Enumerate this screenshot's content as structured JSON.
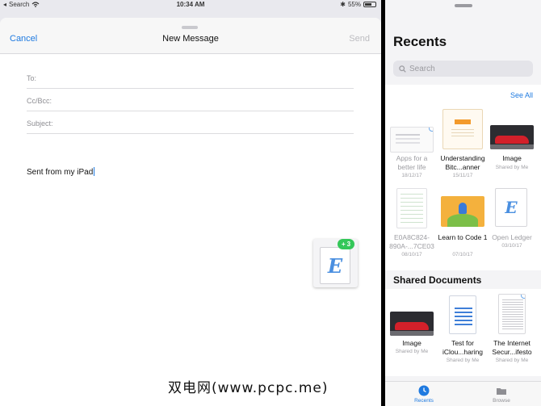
{
  "status_bar": {
    "back_app": "Search",
    "time": "10:34 AM",
    "battery": "55%"
  },
  "mail": {
    "cancel_label": "Cancel",
    "title": "New Message",
    "send_label": "Send",
    "to_label": "To:",
    "cc_label": "Cc/Bcc:",
    "subject_label": "Subject:",
    "body": "Sent from my iPad"
  },
  "drag": {
    "badge_count": "3",
    "glyph": "E"
  },
  "files": {
    "title": "Recents",
    "search_placeholder": "Search",
    "see_all_label": "See All",
    "recents": [
      {
        "name": "Apps for a better life",
        "date": "18/12/17"
      },
      {
        "name": "Understanding Bitc...anner",
        "date": "15/11/17"
      },
      {
        "name": "Image",
        "date": "Shared by Me"
      },
      {
        "name": "E0A8C824-890A-...7CE03",
        "date": "08/10/17"
      },
      {
        "name": "Learn to Code 1",
        "date": "07/10/17"
      },
      {
        "name": "Open Ledger",
        "date": "03/10/17"
      }
    ],
    "shared_title": "Shared Documents",
    "shared": [
      {
        "name": "Image",
        "sub": "Shared by Me"
      },
      {
        "name": "Test for iClou...haring",
        "sub": "Shared by Me"
      },
      {
        "name": "The Internet Secur...ifesto",
        "sub": "Shared by Me"
      }
    ],
    "tabs": {
      "recents": "Recents",
      "browse": "Browse"
    },
    "ledger_glyph": "E"
  },
  "watermark": "双电网(www.pcpc.me)",
  "colors": {
    "accent": "#1f7ae0",
    "badge": "#34c759"
  }
}
